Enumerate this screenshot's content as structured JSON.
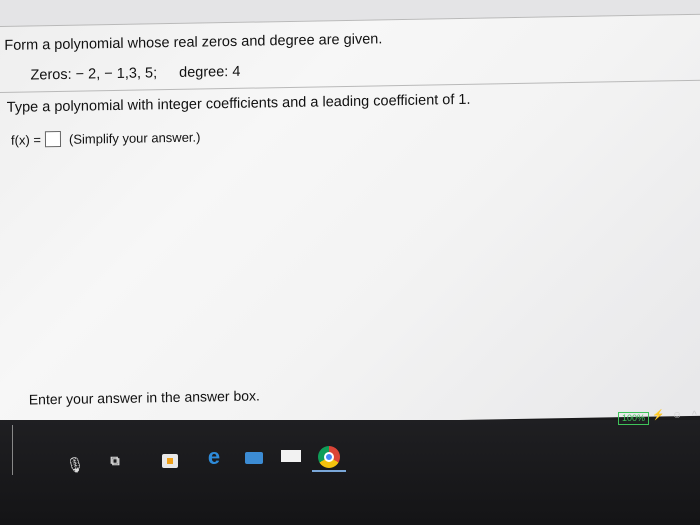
{
  "question": {
    "title": "Form a polynomial whose real zeros and degree are given.",
    "zeros_label": "Zeros:",
    "zeros_values": "− 2, − 1,3, 5;",
    "degree_label": "degree: 4",
    "instruction": "Type a polynomial with integer coefficients and a leading coefficient of 1.",
    "fx_label": "f(x) =",
    "answer_value": "",
    "hint": "(Simplify your answer.)"
  },
  "footer": {
    "enter_prompt": "Enter your answer in the answer box."
  },
  "taskbar": {
    "battery": "100%",
    "icons": [
      "microphone-icon",
      "task-view-icon",
      "store-icon",
      "edge-icon",
      "photos-icon",
      "mail-icon",
      "chrome-icon"
    ]
  },
  "colors": {
    "battery": "#3fc45a",
    "edge": "#2e8bd9"
  }
}
